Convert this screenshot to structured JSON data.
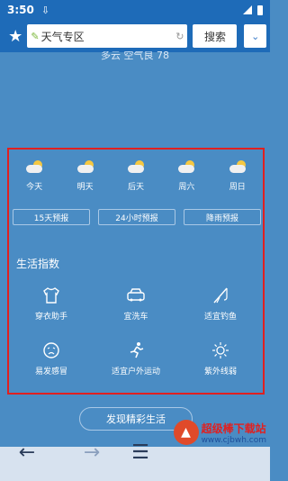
{
  "statusbar": {
    "time": "3:50"
  },
  "search": {
    "value": "天气专区",
    "button": "搜索"
  },
  "weather": {
    "subtitle": "多云 空气良 78"
  },
  "forecast": [
    {
      "label": "今天",
      "icon": "cloudy-sun-icon"
    },
    {
      "label": "明天",
      "icon": "cloudy-sun-icon"
    },
    {
      "label": "后天",
      "icon": "cloudy-sun-icon"
    },
    {
      "label": "周六",
      "icon": "cloudy-sun-icon"
    },
    {
      "label": "周日",
      "icon": "cloudy-sun-icon"
    }
  ],
  "buttons": {
    "b15": "15天预报",
    "b24": "24小时预报",
    "rain": "降雨预报"
  },
  "life": {
    "title": "生活指数",
    "items": [
      {
        "label": "穿衣助手",
        "icon": "shirt-icon"
      },
      {
        "label": "宜洗车",
        "icon": "car-icon"
      },
      {
        "label": "适宜钓鱼",
        "icon": "fishing-icon"
      },
      {
        "label": "易发感冒",
        "icon": "sick-face-icon"
      },
      {
        "label": "适宜户外运动",
        "icon": "running-icon"
      },
      {
        "label": "紫外线弱",
        "icon": "uv-sun-icon"
      }
    ]
  },
  "discover": "发现精彩生活",
  "watermark": {
    "name": "超级棒下载站",
    "url": "www.cjbwh.com"
  },
  "colors": {
    "background": "#4a8cc4",
    "topbar": "#1e6bb8",
    "highlight": "#e02020"
  }
}
